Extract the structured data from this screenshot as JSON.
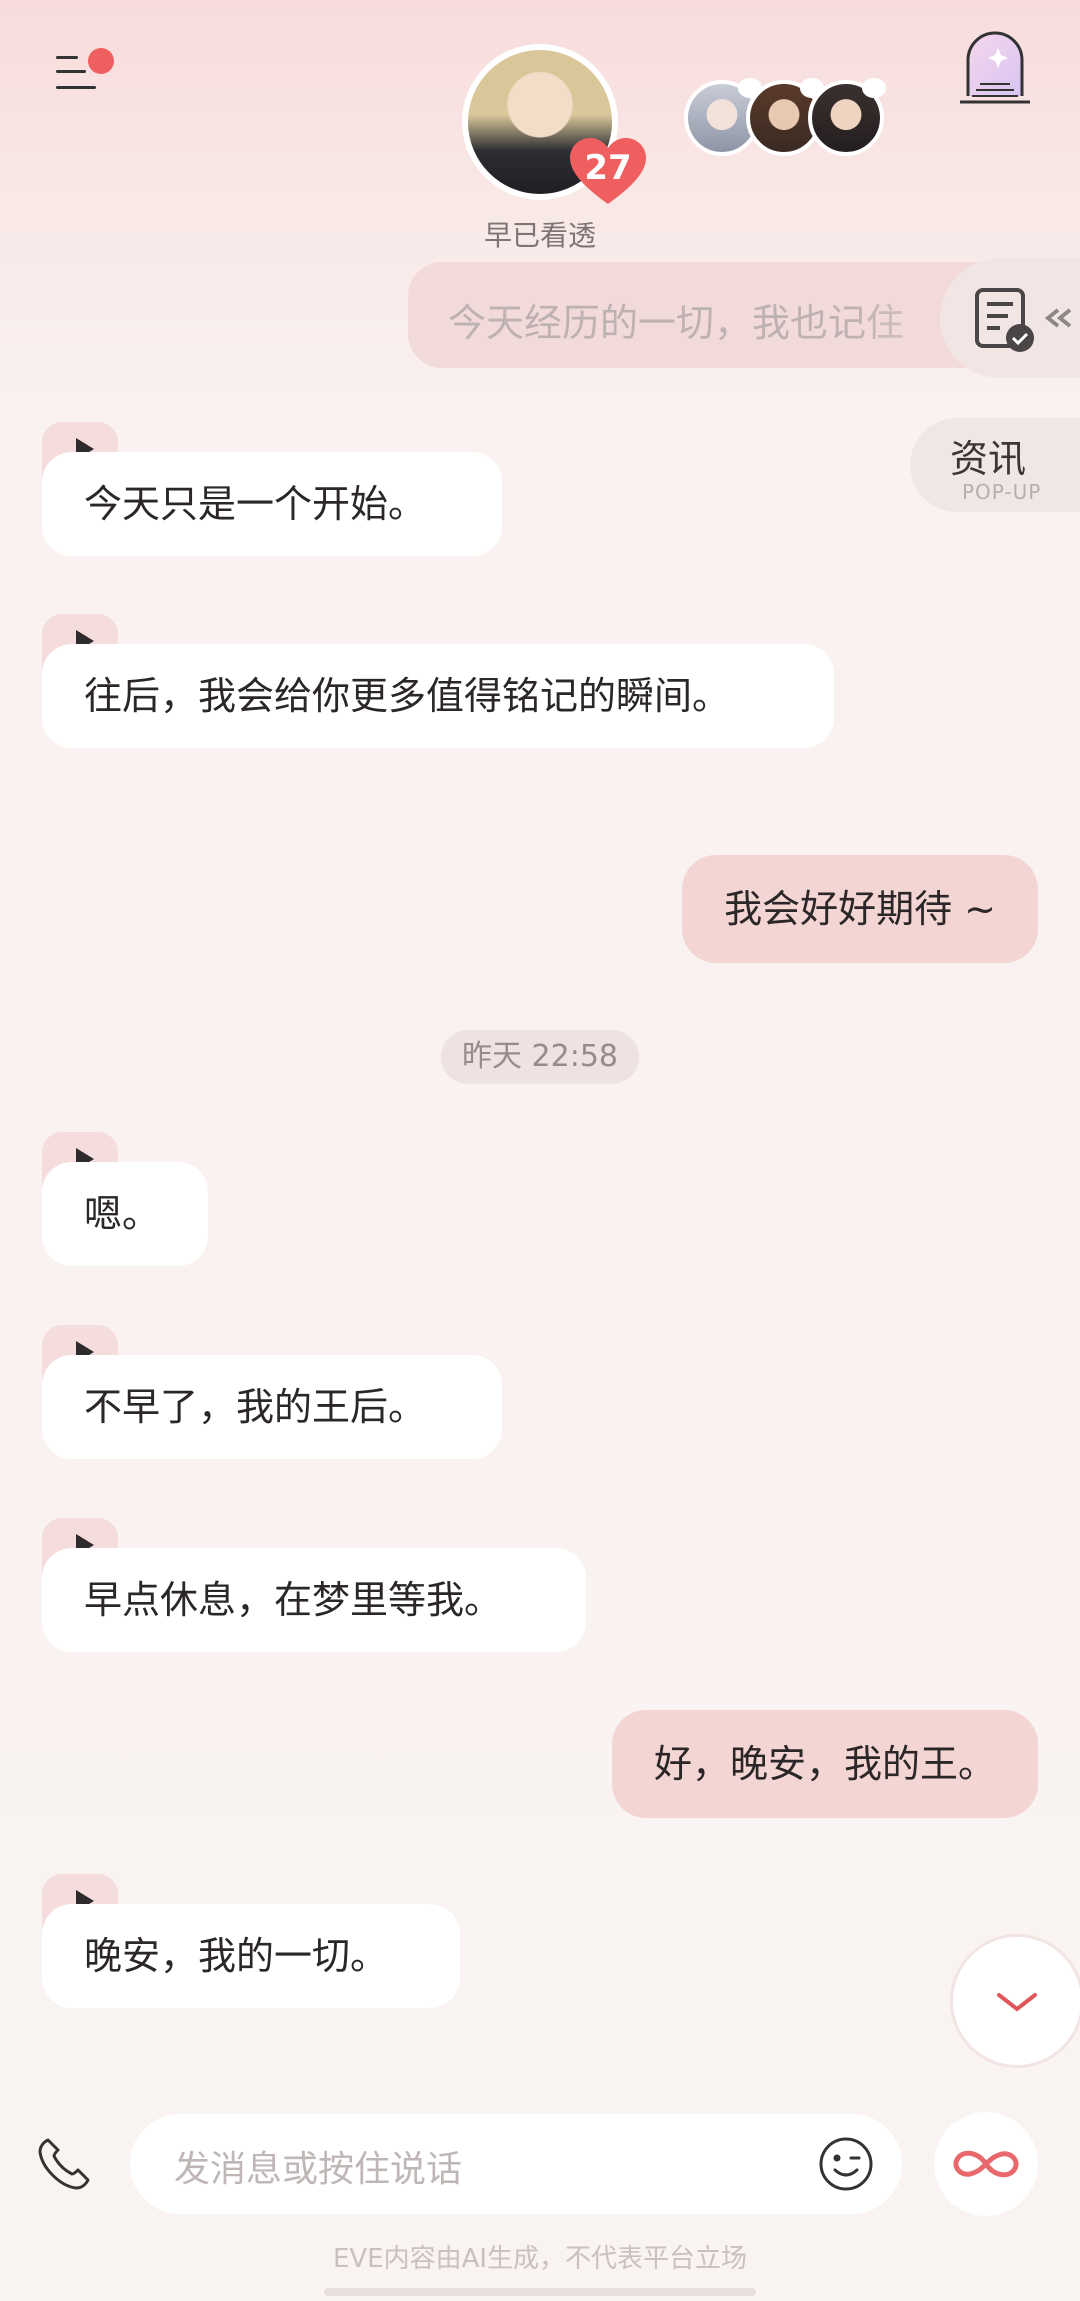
{
  "header": {
    "character_name": "早已看透",
    "affinity_level": "27"
  },
  "messages": {
    "top_partial": "今天经历的一切，我也记住",
    "m1": "今天只是一个开始。",
    "m2": "往后，我会给你更多值得铭记的瞬间。",
    "m3": "我会好好期待 ~",
    "timestamp": "昨天 22:58",
    "m4": "嗯。",
    "m5": "不早了，我的王后。",
    "m6": "早点休息，在梦里等我。",
    "m7": "好，晚安，我的王。",
    "m8": "晚安，我的一切。"
  },
  "side": {
    "popup_title": "资讯",
    "popup_subtitle": "POP-UP"
  },
  "input": {
    "placeholder": "发消息或按住说话"
  },
  "footer": {
    "disclaimer": "EVE内容由AI生成，不代表平台立场"
  },
  "colors": {
    "accent": "#f05f60",
    "user_bubble": "#f3d6d4",
    "bot_bubble": "#ffffff"
  }
}
